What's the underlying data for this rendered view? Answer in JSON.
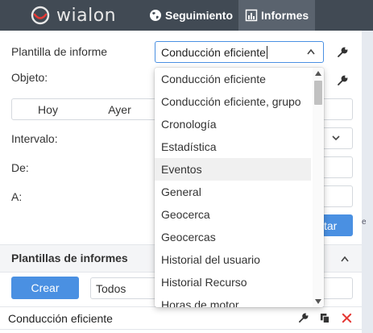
{
  "app": {
    "brand": "wialon"
  },
  "nav": {
    "tracking_label": "Seguimiento",
    "reports_label": "Informes"
  },
  "form": {
    "template_label": "Plantilla de informe",
    "template_value": "Conducción eficiente",
    "object_label": "Objeto:",
    "today_label": "Hoy",
    "yesterday_label": "Ayer",
    "interval_label": "Intervalo:",
    "from_label": "De:",
    "to_label": "A:",
    "execute_label": "tar"
  },
  "templates_section": {
    "title": "Plantillas de informes",
    "create_label": "Crear",
    "filter_value": "Todos",
    "rows": [
      {
        "name": "Conducción eficiente"
      }
    ]
  },
  "dropdown": {
    "options": [
      "Conducción eficiente",
      "Conducción eficiente, grupo",
      "Cronología",
      "Estadística",
      "Eventos",
      "General",
      "Geocerca",
      "Geocercas",
      "Historial del usuario",
      "Historial Recurso",
      "Horas de motor"
    ],
    "hovered_option": "Eventos"
  },
  "map": {
    "edge_label": "e"
  },
  "colors": {
    "topbar": "#414a54",
    "accent": "#4a90e2",
    "delete": "#e53935"
  }
}
